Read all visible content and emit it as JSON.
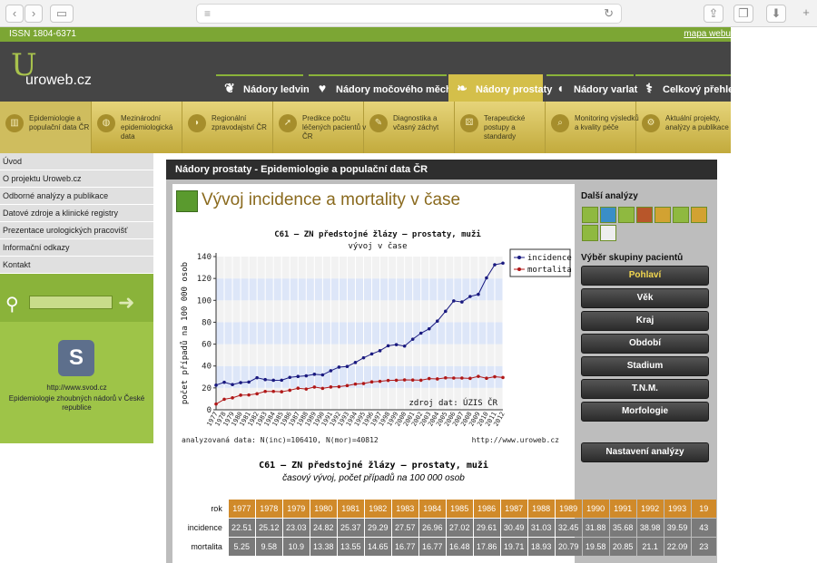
{
  "browser": {
    "nav_back": "‹",
    "nav_forward": "›"
  },
  "top": {
    "issn": "ISSN 1804-6371",
    "sitemap": "mapa webu"
  },
  "logo": {
    "letter": "U",
    "name": "uroweb.cz"
  },
  "tabs": [
    {
      "label": "Nádory ledvin",
      "icon": "kidney-icon"
    },
    {
      "label": "Nádory močového měchýře",
      "icon": "bladder-icon"
    },
    {
      "label": "Nádory prostaty",
      "icon": "prostate-icon"
    },
    {
      "label": "Nádory varlat",
      "icon": "testis-icon"
    },
    {
      "label": "Celkový přehled",
      "icon": "caduceus-icon"
    }
  ],
  "subnav": [
    {
      "label": "Epidemiologie a populační data ČR"
    },
    {
      "label": "Mezinárodní epidemiologická data"
    },
    {
      "label": "Regionální zpravodajství ČR"
    },
    {
      "label": "Predikce počtu léčených pacientů v ČR"
    },
    {
      "label": "Diagnostika a včasný záchyt"
    },
    {
      "label": "Terapeutické postupy a standardy"
    },
    {
      "label": "Monitoring výsledků a kvality péče"
    },
    {
      "label": "Aktuální projekty, analýzy a publikace"
    }
  ],
  "sidebar": {
    "items": [
      "Úvod",
      "O projektu Uroweb.cz",
      "Odborné analýzy a publikace",
      "Datové zdroje a klinické registry",
      "Prezentace urologických pracovišť",
      "Informační odkazy",
      "Kontakt"
    ],
    "svod_url": "http://www.svod.cz",
    "svod_desc": "Epidemiologie zhoubných nádorů v České republice"
  },
  "panel": {
    "header": "Nádory prostaty - Epidemiologie a populační data ČR",
    "title": "Vývoj incidence a mortality v čase",
    "caption1": "C61 – ZN předstojné žlázy – prostaty, muži",
    "caption2": "časový vývoj, počet případů na 100 000 osob"
  },
  "right": {
    "analyses_title": "Další analýzy",
    "groups_title": "Výběr skupiny pacientů",
    "groups": [
      "Pohlaví",
      "Věk",
      "Kraj",
      "Období",
      "Stadium",
      "T.N.M.",
      "Morfologie"
    ],
    "settings": "Nastavení analýzy"
  },
  "chart_data": {
    "type": "line",
    "title": "C61 – ZN předstojné žlázy – prostaty, muži",
    "subtitle": "vývoj v čase",
    "ylabel": "počet případů na 100 000 osob",
    "source": "zdroj dat: ÚZIS ČR",
    "footer_left": "analyzovaná data: N(inc)=106410, N(mor)=40812",
    "footer_right": "http://www.uroweb.cz",
    "ylim": [
      0,
      140
    ],
    "yticks": [
      0,
      20,
      40,
      60,
      80,
      100,
      120,
      140
    ],
    "grid": true,
    "legend": "top-right",
    "x": [
      1977,
      1978,
      1979,
      1980,
      1981,
      1982,
      1983,
      1984,
      1985,
      1986,
      1987,
      1988,
      1989,
      1990,
      1991,
      1992,
      1993,
      1994,
      1995,
      1996,
      1997,
      1998,
      1999,
      2000,
      2001,
      2002,
      2003,
      2004,
      2005,
      2006,
      2007,
      2008,
      2009,
      2010,
      2011,
      2012
    ],
    "series": [
      {
        "name": "incidence",
        "color": "#1a1a80",
        "values": [
          22.51,
          25.12,
          23.03,
          24.82,
          25.37,
          29.29,
          27.57,
          26.96,
          27.02,
          29.61,
          30.49,
          31.03,
          32.45,
          31.88,
          35.68,
          38.98,
          39.59,
          43.2,
          47.5,
          51.0,
          54.0,
          58.5,
          59.5,
          58.2,
          64.5,
          70.0,
          74.0,
          81.0,
          90.0,
          99.5,
          98.5,
          103.5,
          105.5,
          120.5,
          132.5,
          134.0
        ]
      },
      {
        "name": "mortalita",
        "color": "#b01818",
        "values": [
          5.25,
          9.58,
          10.9,
          13.38,
          13.55,
          14.65,
          16.77,
          16.77,
          16.48,
          17.86,
          19.71,
          18.93,
          20.79,
          19.58,
          20.85,
          21.1,
          22.09,
          23.5,
          24.0,
          25.5,
          26.0,
          26.8,
          27.0,
          27.3,
          27.2,
          27.0,
          28.5,
          28.2,
          29.2,
          29.0,
          29.0,
          28.7,
          30.5,
          28.8,
          30.2,
          29.5
        ]
      }
    ]
  },
  "table": {
    "row_labels": [
      "rok",
      "incidence",
      "mortalita"
    ],
    "years": [
      "1977",
      "1978",
      "1979",
      "1980",
      "1981",
      "1982",
      "1983",
      "1984",
      "1985",
      "1986",
      "1987",
      "1988",
      "1989",
      "1990",
      "1991",
      "1992",
      "1993",
      "19"
    ],
    "incidence": [
      "22.51",
      "25.12",
      "23.03",
      "24.82",
      "25.37",
      "29.29",
      "27.57",
      "26.96",
      "27.02",
      "29.61",
      "30.49",
      "31.03",
      "32.45",
      "31.88",
      "35.68",
      "38.98",
      "39.59",
      "43"
    ],
    "mortalita": [
      "5.25",
      "9.58",
      "10.9",
      "13.38",
      "13.55",
      "14.65",
      "16.77",
      "16.77",
      "16.48",
      "17.86",
      "19.71",
      "18.93",
      "20.79",
      "19.58",
      "20.85",
      "21.1",
      "22.09",
      "23"
    ]
  }
}
